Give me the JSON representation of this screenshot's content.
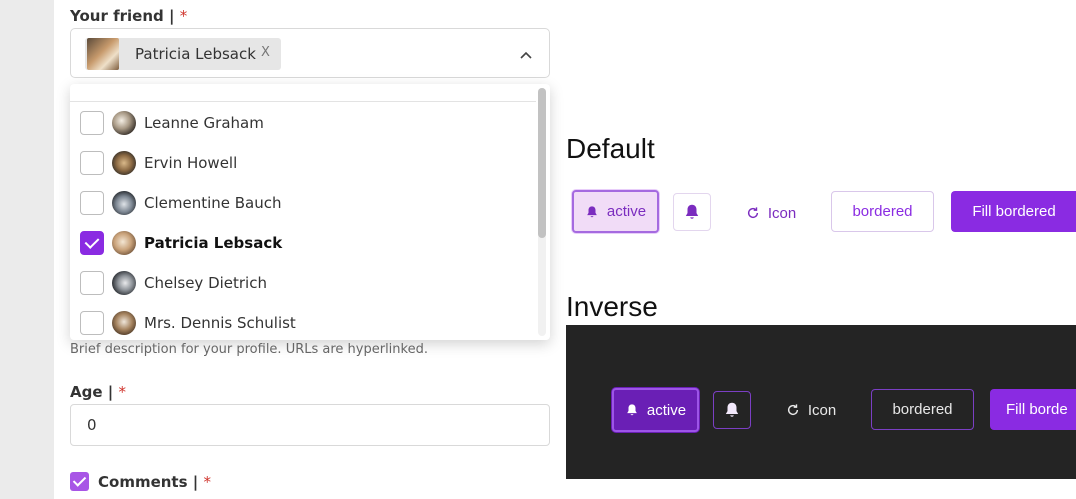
{
  "form": {
    "friend_label": "Your friend |",
    "required_mark": "*",
    "selected_chip": {
      "name": "Patricia Lebsack",
      "remove": "X"
    },
    "options": [
      {
        "name": "Leanne Graham",
        "checked": false
      },
      {
        "name": "Ervin Howell",
        "checked": false
      },
      {
        "name": "Clementine Bauch",
        "checked": false
      },
      {
        "name": "Patricia Lebsack",
        "checked": true
      },
      {
        "name": "Chelsey Dietrich",
        "checked": false
      },
      {
        "name": "Mrs. Dennis Schulist",
        "checked": false
      }
    ],
    "bio_help": "Brief description for your profile. URLs are hyperlinked.",
    "age_label": "Age |",
    "age_value": "0",
    "comments_label": "Comments |",
    "comments_checked": true
  },
  "showcase": {
    "default_heading": "Default",
    "inverse_heading": "Inverse",
    "buttons": {
      "active": "active",
      "icon": "Icon",
      "bordered": "bordered",
      "fill_bordered": "Fill bordered",
      "fill_bordered_inverse": "Fill borde"
    }
  },
  "colors": {
    "accent": "#8a2be2",
    "accent_light": "#f1dcf7",
    "required": "#d0342c",
    "inverse_bg": "#242424"
  },
  "icons": {
    "bell": "bell-icon",
    "refresh": "refresh-icon",
    "caret": "chevron-up-icon",
    "check": "check-icon"
  }
}
